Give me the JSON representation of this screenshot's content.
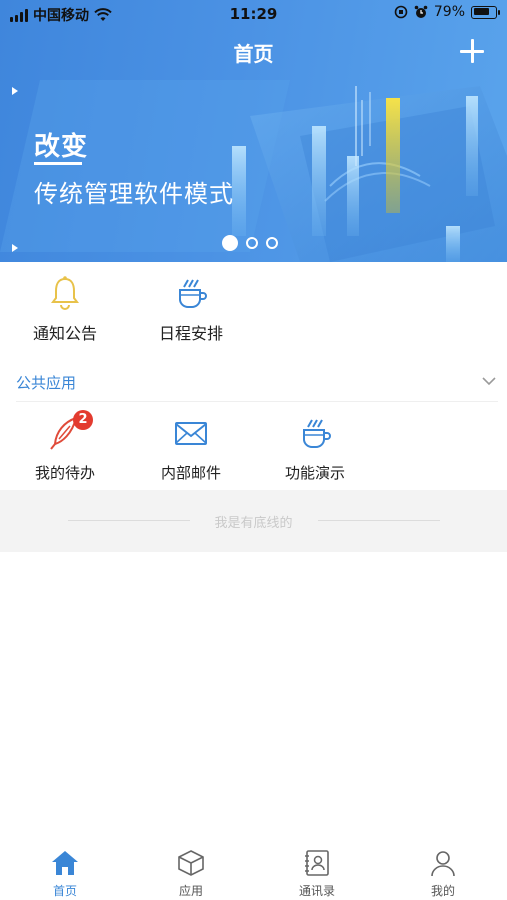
{
  "status_bar": {
    "carrier": "中国移动",
    "time": "11:29",
    "battery": "79%",
    "battery_level": 0.79
  },
  "nav": {
    "title": "首页",
    "add_icon": "plus-icon"
  },
  "banner": {
    "title": "改变",
    "subtitle": "传统管理软件模式",
    "slides_count": 3,
    "active_slide": 1
  },
  "quick_access": [
    {
      "label": "通知公告",
      "icon": "bell-icon",
      "color": "#e8c24a"
    },
    {
      "label": "日程安排",
      "icon": "coffee-cup-icon",
      "color": "#3a86d6"
    }
  ],
  "public_apps": {
    "section_title": "公共应用",
    "items": [
      {
        "label": "我的待办",
        "icon": "quill-icon",
        "badge": "2",
        "color": "#e04b3a"
      },
      {
        "label": "内部邮件",
        "icon": "envelope-icon",
        "color": "#3a86d6"
      },
      {
        "label": "功能演示",
        "icon": "coffee-cup-icon",
        "color": "#3a86d6"
      }
    ]
  },
  "footer": {
    "text": "我是有底线的"
  },
  "tabbar": {
    "items": [
      {
        "label": "首页",
        "icon": "home-icon",
        "active": true
      },
      {
        "label": "应用",
        "icon": "cube-icon",
        "active": false
      },
      {
        "label": "通讯录",
        "icon": "contacts-book-icon",
        "active": false
      },
      {
        "label": "我的",
        "icon": "user-icon",
        "active": false
      }
    ]
  },
  "colors": {
    "primary": "#3a86d6",
    "badge": "#e33b2f",
    "header_bg": "#4b92e4"
  }
}
